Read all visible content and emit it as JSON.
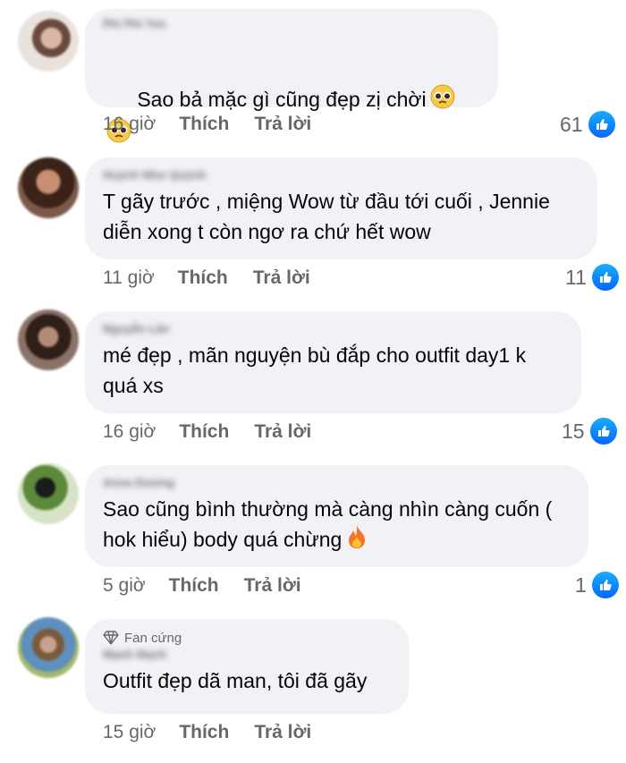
{
  "comments": [
    {
      "author": "Phi Phi Yen",
      "text": "Sao bả mặc gì cũng đẹp zị chời",
      "emoji": [
        "pleading-face",
        "pleading-face"
      ],
      "time": "16 giờ",
      "like_label": "Thích",
      "reply_label": "Trả lời",
      "reactions": "61"
    },
    {
      "author": "Huỳnh Như Quỳnh",
      "text": "T gãy trước , miệng Wow từ đầu tới cuối , Jennie diễn xong t còn ngơ ra chứ hết wow",
      "time": "11 giờ",
      "like_label": "Thích",
      "reply_label": "Trả lời",
      "reactions": "11"
    },
    {
      "author": "Nguyễn Lân",
      "text": "mé đẹp , mãn nguyện bù đắp cho outfit day1 k quá xs",
      "time": "16 giờ",
      "like_label": "Thích",
      "reply_label": "Trả lời",
      "reactions": "15"
    },
    {
      "author": "Anna Dương",
      "text": "Sao cũng bình thường mà càng nhìn càng cuốn ( hok hiểu) body quá chừng",
      "emoji": [
        "fire"
      ],
      "time": "5 giờ",
      "like_label": "Thích",
      "reply_label": "Trả lời",
      "reactions": "1"
    },
    {
      "badge": "Fan cứng",
      "author": "Mạnh Mạnh",
      "text": "Outfit đẹp dã man, tôi đã gãy",
      "time": "15 giờ",
      "like_label": "Thích",
      "reply_label": "Trả lời"
    }
  ],
  "colors": {
    "bubble": "#f0f2f5",
    "meta": "#65676b",
    "like_blue": "#0866ff"
  }
}
